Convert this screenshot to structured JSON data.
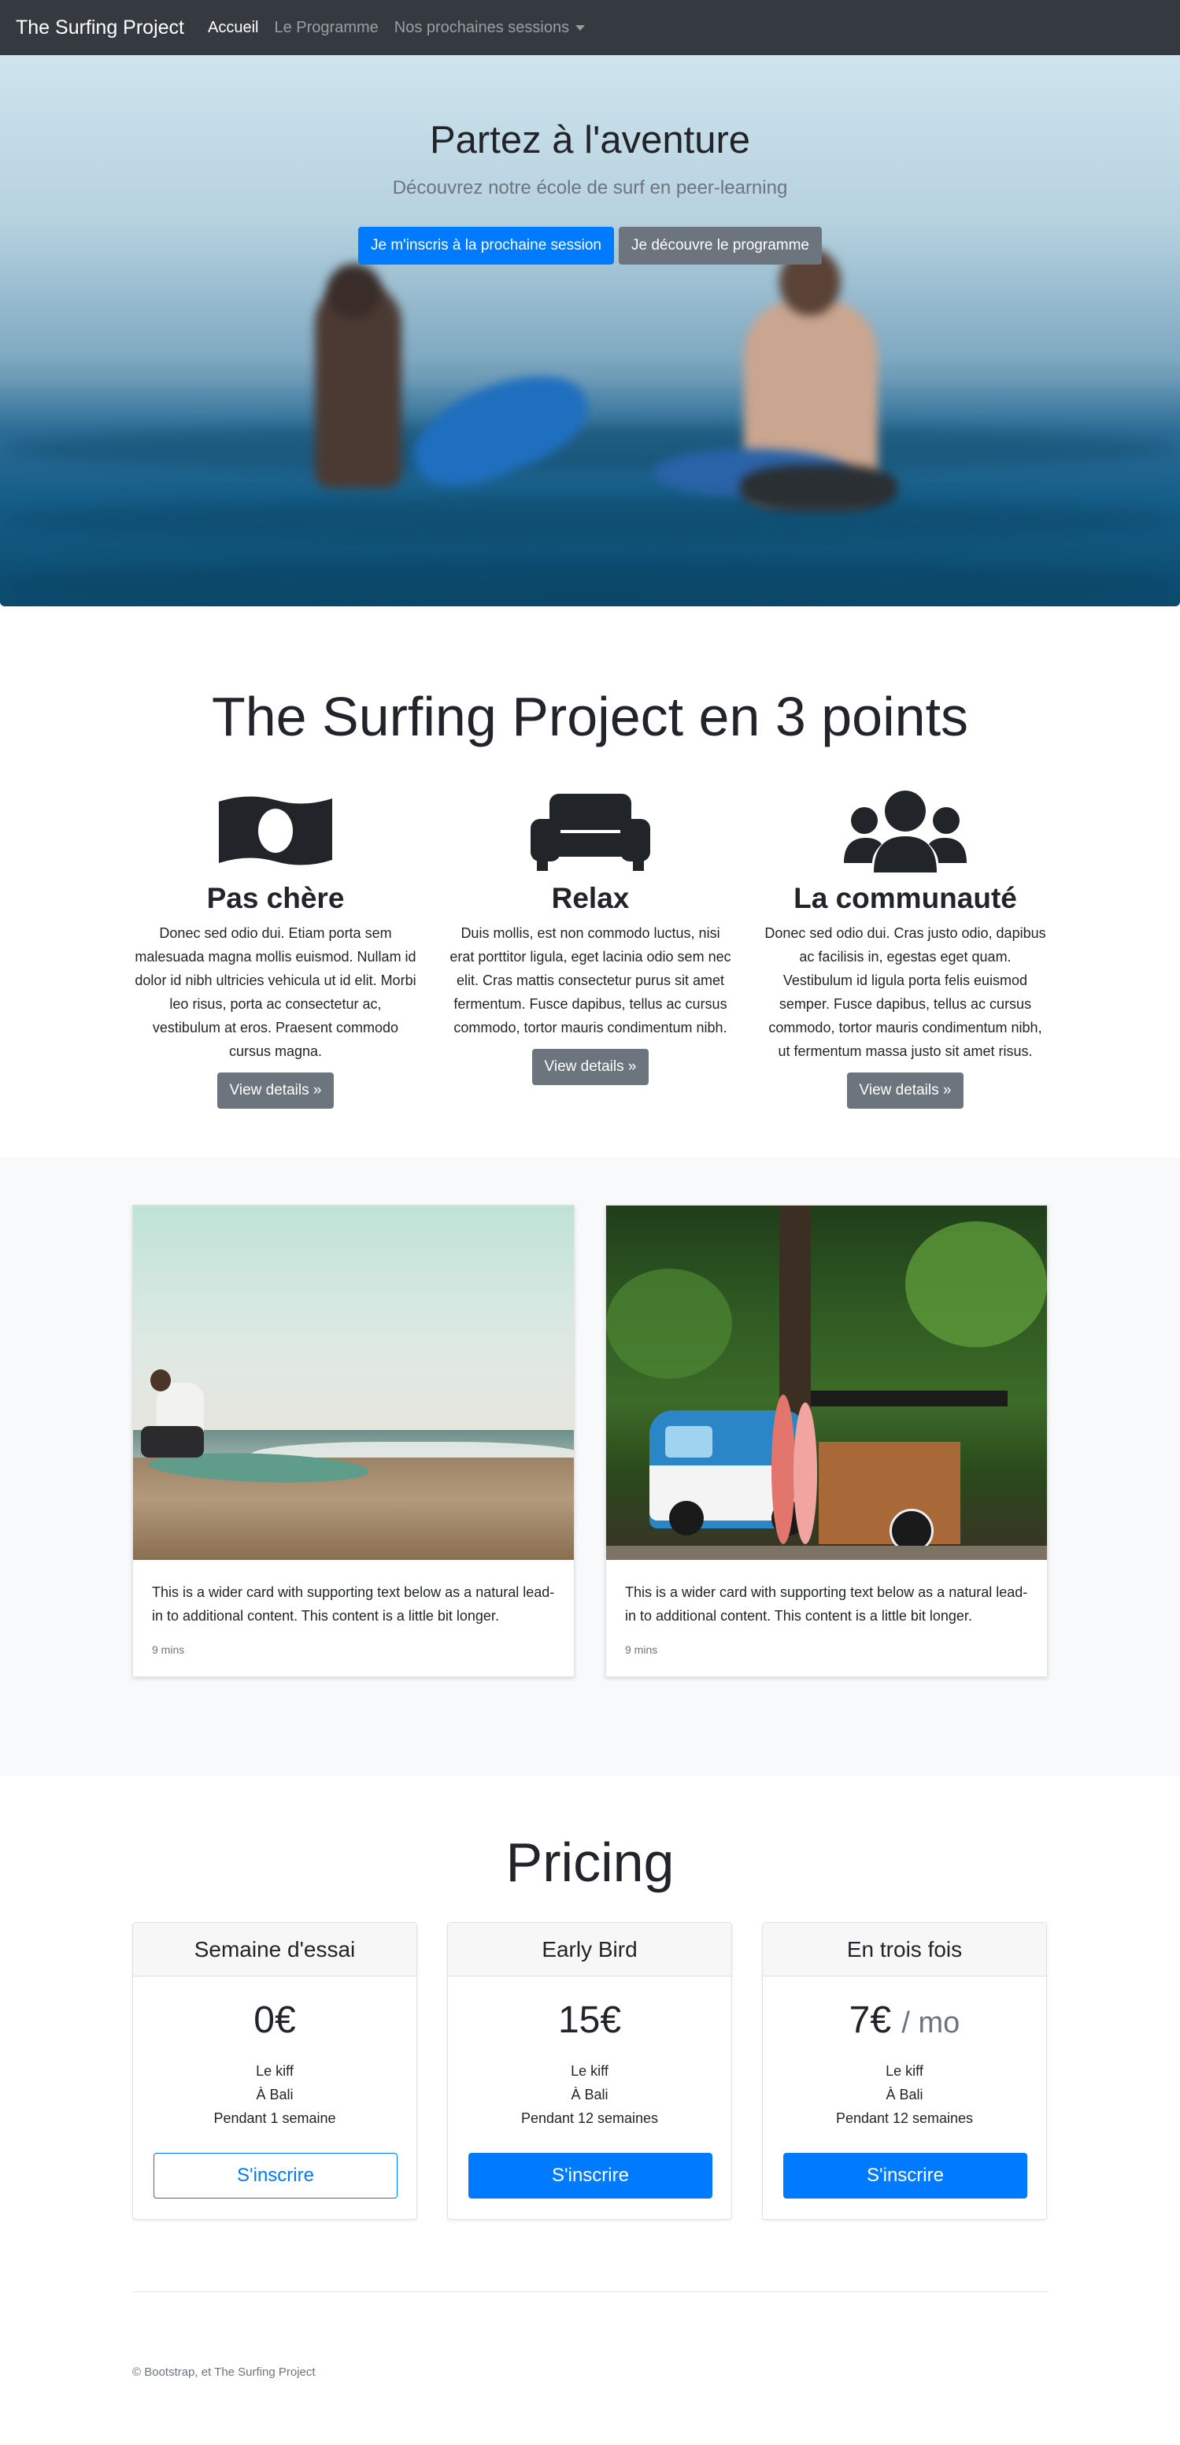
{
  "navbar": {
    "brand": "The Surfing Project",
    "links": [
      {
        "label": "Accueil"
      },
      {
        "label": "Le Programme"
      },
      {
        "label": "Nos prochaines sessions"
      }
    ]
  },
  "hero": {
    "title": "Partez à l'aventure",
    "subtitle": "Découvrez notre école de surf en peer-learning",
    "primary_button": "Je m'inscris à la prochaine session",
    "secondary_button": "Je découvre le programme"
  },
  "features": {
    "title": "The Surfing Project en 3 points",
    "items": [
      {
        "icon": "money-bill-icon",
        "heading": "Pas chère",
        "text": "Donec sed odio dui. Etiam porta sem malesuada magna mollis euismod. Nullam id dolor id nibh ultricies vehicula ut id elit. Morbi leo risus, porta ac consectetur ac, vestibulum at eros. Praesent commodo cursus magna.",
        "button": "View details »"
      },
      {
        "icon": "couch-icon",
        "heading": "Relax",
        "text": "Duis mollis, est non commodo luctus, nisi erat porttitor ligula, eget lacinia odio sem nec elit. Cras mattis consectetur purus sit amet fermentum. Fusce dapibus, tellus ac cursus commodo, tortor mauris condimentum nibh.",
        "button": "View details »"
      },
      {
        "icon": "users-icon",
        "heading": "La communauté",
        "text": "Donec sed odio dui. Cras justo odio, dapibus ac facilisis in, egestas eget quam. Vestibulum id ligula porta felis euismod semper. Fusce dapibus, tellus ac cursus commodo, tortor mauris condimentum nibh, ut fermentum massa justo sit amet risus.",
        "button": "View details »"
      }
    ]
  },
  "album": {
    "cards": [
      {
        "text": "This is a wider card with supporting text below as a natural lead-in to additional content. This content is a little bit longer.",
        "meta": "9 mins"
      },
      {
        "text": "This is a wider card with supporting text below as a natural lead-in to additional content. This content is a little bit longer.",
        "meta": "9 mins"
      }
    ]
  },
  "pricing": {
    "title": "Pricing",
    "plans": [
      {
        "name": "Semaine d'essai",
        "price": "0€",
        "period": "",
        "features": [
          "Le kiff",
          "À Bali",
          "Pendant 1 semaine"
        ],
        "button": "S'inscrire"
      },
      {
        "name": "Early Bird",
        "price": "15€",
        "period": "",
        "features": [
          "Le kiff",
          "À Bali",
          "Pendant 12 semaines"
        ],
        "button": "S'inscrire"
      },
      {
        "name": "En trois fois",
        "price": "7€",
        "period": "/ mo",
        "features": [
          "Le kiff",
          "À Bali",
          "Pendant 12 semaines"
        ],
        "button": "S'inscrire"
      }
    ]
  },
  "footer": {
    "text": "© Bootstrap, et The Surfing Project"
  }
}
